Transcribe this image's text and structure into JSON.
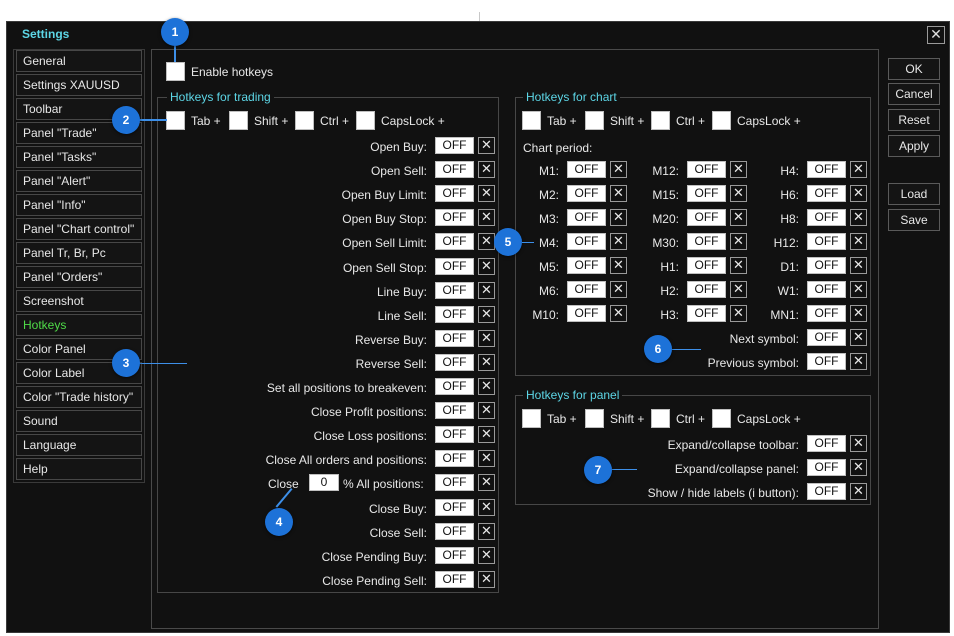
{
  "window": {
    "title": "Settings",
    "close_glyph": "✕"
  },
  "sidebar": {
    "items": [
      "General",
      "Settings XAUUSD",
      "Toolbar",
      "Panel \"Trade\"",
      "Panel \"Tasks\"",
      "Panel \"Alert\"",
      "Panel \"Info\"",
      "Panel \"Chart control\"",
      "Panel Tr, Br, Pc",
      "Panel \"Orders\"",
      "Screenshot",
      "Hotkeys",
      "Color Panel",
      "Color Label",
      "Color \"Trade history\"",
      "Sound",
      "Language",
      "Help"
    ],
    "active": "Hotkeys"
  },
  "buttons": {
    "ok": "OK",
    "cancel": "Cancel",
    "reset": "Reset",
    "apply": "Apply",
    "load": "Load",
    "save": "Save"
  },
  "enable_hotkeys": "Enable hotkeys",
  "trading": {
    "title": "Hotkeys for trading",
    "mods": [
      "Tab +",
      "Shift +",
      "Ctrl +",
      "CapsLock +"
    ],
    "rows": [
      "Open Buy:",
      "Open Sell:",
      "Open Buy Limit:",
      "Open Buy Stop:",
      "Open Sell Limit:",
      "Open Sell Stop:",
      "Line Buy:",
      "Line Sell:",
      "Reverse Buy:",
      "Reverse Sell:",
      "Set all positions to breakeven:",
      "Close Profit positions:",
      "Close Loss positions:",
      "Close All orders and positions:",
      "PERCENT_ROW",
      "Close Buy:",
      "Close Sell:",
      "Close Pending Buy:",
      "Close Pending Sell:"
    ],
    "close_prefix": "Close",
    "percent_value": "0",
    "percent_suffix": "% All positions:"
  },
  "chart": {
    "title": "Hotkeys for chart",
    "mods": [
      "Tab +",
      "Shift +",
      "Ctrl +",
      "CapsLock +"
    ],
    "period_label": "Chart period:",
    "col1": [
      "M1:",
      "M2:",
      "M3:",
      "M4:",
      "M5:",
      "M6:",
      "M10:"
    ],
    "col2": [
      "M12:",
      "M15:",
      "M20:",
      "M30:",
      "H1:",
      "H2:",
      "H3:"
    ],
    "col3": [
      "H4:",
      "H6:",
      "H8:",
      "H12:",
      "D1:",
      "W1:",
      "MN1:"
    ],
    "next": "Next symbol:",
    "prev": "Previous symbol:"
  },
  "panel": {
    "title": "Hotkeys for panel",
    "mods": [
      "Tab +",
      "Shift +",
      "Ctrl +",
      "CapsLock +"
    ],
    "rows": [
      "Expand/collapse toolbar:",
      "Expand/collapse panel:",
      "Show / hide labels (i button):"
    ]
  },
  "off_value": "OFF",
  "x_glyph": "✕",
  "callouts": [
    "1",
    "2",
    "3",
    "4",
    "5",
    "6",
    "7"
  ],
  "colors": {
    "accent_title": "#5dd6e6",
    "active_item": "#4fdc48",
    "callout": "#1d72d8",
    "background": "#111111"
  }
}
